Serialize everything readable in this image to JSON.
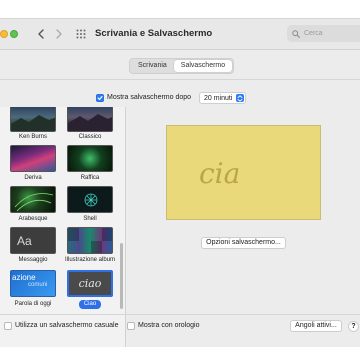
{
  "window": {
    "title": "Scrivania e Salvaschermo"
  },
  "search": {
    "placeholder": "Cerca"
  },
  "tabs": [
    {
      "label": "Scrivania",
      "active": false
    },
    {
      "label": "Salvaschermo",
      "active": true
    }
  ],
  "options": {
    "show_after_label": "Mostra salvaschermo dopo",
    "show_after_checked": true,
    "delay_value": "20 minuti"
  },
  "screensavers": [
    {
      "label": "Ken Burns",
      "selected": false
    },
    {
      "label": "Classico",
      "selected": false
    },
    {
      "label": "Deriva",
      "selected": false
    },
    {
      "label": "Raffica",
      "selected": false
    },
    {
      "label": "Arabesque",
      "selected": false
    },
    {
      "label": "Shell",
      "selected": false
    },
    {
      "label": "Messaggio",
      "selected": false
    },
    {
      "label": "Illustrazione album",
      "selected": false
    },
    {
      "label": "Parola di oggi",
      "selected": false
    },
    {
      "label": "Ciao",
      "selected": true
    }
  ],
  "thumb_text": {
    "messaggio": "Aa",
    "parola_line1": "azione",
    "parola_line2": "comuni",
    "ciao": "ciao"
  },
  "preview": {
    "text": "cia"
  },
  "buttons": {
    "options_label": "Opzioni salvaschermo...",
    "hot_corners_label": "Angoli attivi...",
    "help_label": "?"
  },
  "footer": {
    "random_label": "Utilizza un salvaschermo casuale",
    "random_checked": false,
    "clock_label": "Mostra con orologio",
    "clock_checked": false
  },
  "colors": {
    "accent": "#2f7bf5",
    "preview_background": "#e9d97a",
    "preview_text": "#b8a744"
  }
}
